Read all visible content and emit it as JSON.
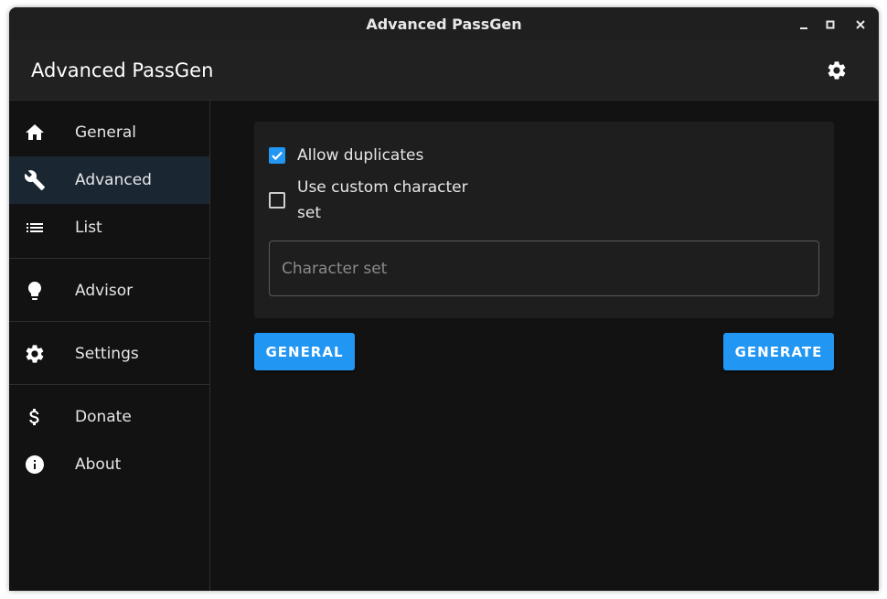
{
  "window": {
    "title": "Advanced PassGen",
    "controls": [
      "minimize-icon",
      "maximize-icon",
      "close-icon"
    ]
  },
  "appbar": {
    "title": "Advanced PassGen",
    "settings_icon": "gear-icon"
  },
  "sidebar": {
    "items": [
      {
        "label": "General",
        "icon": "home-icon",
        "active": false
      },
      {
        "label": "Advanced",
        "icon": "wrench-icon",
        "active": true
      },
      {
        "label": "List",
        "icon": "list-icon",
        "active": false
      },
      {
        "label": "Advisor",
        "icon": "lightbulb-icon",
        "active": false
      },
      {
        "label": "Settings",
        "icon": "gear-icon",
        "active": false
      },
      {
        "label": "Donate",
        "icon": "dollar-icon",
        "active": false
      },
      {
        "label": "About",
        "icon": "info-icon",
        "active": false
      }
    ]
  },
  "main": {
    "allow_duplicates": {
      "label": "Allow duplicates",
      "checked": true
    },
    "custom_charset": {
      "label_line1": "Use custom character",
      "label_line2": "set",
      "checked": false
    },
    "charset_field": {
      "placeholder": "Character set",
      "value": ""
    },
    "general_button": "GENERAL",
    "generate_button": "GENERATE"
  },
  "colors": {
    "accent": "#2196f3",
    "background": "#121212",
    "surface": "#1e1e1e",
    "appbar": "#212121",
    "active_nav": "#1a2632"
  }
}
